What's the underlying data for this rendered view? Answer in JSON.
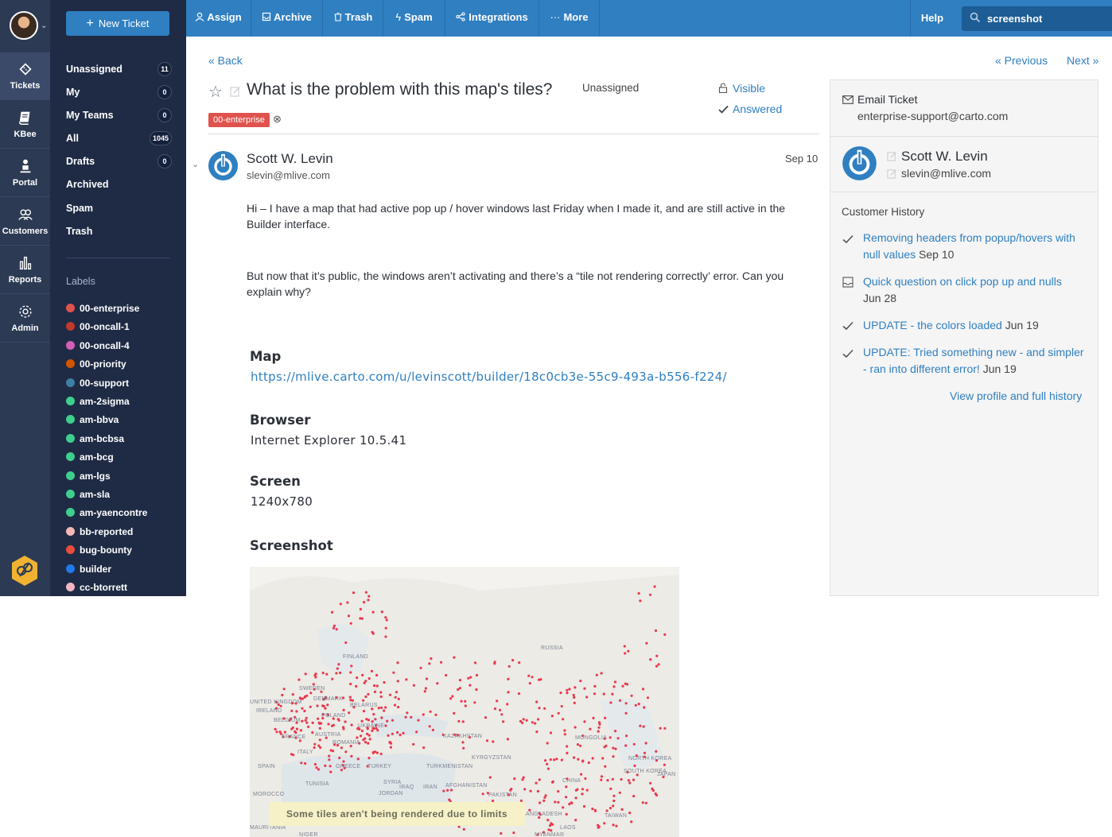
{
  "rail": {
    "items": [
      {
        "label": "Tickets",
        "icon": "ticket-icon"
      },
      {
        "label": "KBee",
        "icon": "book-icon"
      },
      {
        "label": "Portal",
        "icon": "portal-icon"
      },
      {
        "label": "Customers",
        "icon": "customers-icon"
      },
      {
        "label": "Reports",
        "icon": "reports-icon"
      },
      {
        "label": "Admin",
        "icon": "gear-icon"
      }
    ]
  },
  "sidebar": {
    "new_ticket": "New Ticket",
    "folders": [
      {
        "label": "Unassigned",
        "count": "11"
      },
      {
        "label": "My",
        "count": "0"
      },
      {
        "label": "My Teams",
        "count": "0"
      },
      {
        "label": "All",
        "count": "1045"
      },
      {
        "label": "Drafts",
        "count": "0"
      },
      {
        "label": "Archived",
        "count": ""
      },
      {
        "label": "Spam",
        "count": ""
      },
      {
        "label": "Trash",
        "count": ""
      }
    ],
    "labels_title": "Labels",
    "labels": [
      {
        "name": "00-enterprise",
        "color": "#e0524d"
      },
      {
        "name": "00-oncall-1",
        "color": "#c0392b"
      },
      {
        "name": "00-oncall-4",
        "color": "#d35fb7"
      },
      {
        "name": "00-priority",
        "color": "#d35400"
      },
      {
        "name": "00-support",
        "color": "#3d7ea6"
      },
      {
        "name": "am-2sigma",
        "color": "#3ecf8e"
      },
      {
        "name": "am-bbva",
        "color": "#3ecf8e"
      },
      {
        "name": "am-bcbsa",
        "color": "#3ecf8e"
      },
      {
        "name": "am-bcg",
        "color": "#3ecf8e"
      },
      {
        "name": "am-lgs",
        "color": "#3ecf8e"
      },
      {
        "name": "am-sla",
        "color": "#3ecf8e"
      },
      {
        "name": "am-yaencontre",
        "color": "#3ecf8e"
      },
      {
        "name": "bb-reported",
        "color": "#f4b6b6"
      },
      {
        "name": "bug-bounty",
        "color": "#e74c3c"
      },
      {
        "name": "builder",
        "color": "#1f7bea"
      },
      {
        "name": "cc-btorrett",
        "color": "#f4b6c2"
      }
    ]
  },
  "toolbar": {
    "buttons": [
      {
        "label": "Assign",
        "icon": "user-icon"
      },
      {
        "label": "Archive",
        "icon": "archive-icon"
      },
      {
        "label": "Trash",
        "icon": "trash-icon"
      },
      {
        "label": "Spam",
        "icon": "bolt-icon"
      },
      {
        "label": "Integrations",
        "icon": "share-icon"
      },
      {
        "label": "More",
        "icon": "ellipsis-icon"
      }
    ],
    "help": "Help",
    "search_value": "screenshot"
  },
  "ticket": {
    "back": "« Back",
    "previous": "« Previous",
    "next": "Next »",
    "title": "What is the problem with this map's tiles?",
    "assignee": "Unassigned",
    "visibility": "Visible",
    "status": "Answered",
    "tag": "00-enterprise",
    "message": {
      "sender": "Scott W. Levin",
      "email": "slevin@mlive.com",
      "date": "Sep 10",
      "para1": "Hi – I have a map that had active pop up / hover windows last Friday when I made it, and are still active in the Builder interface.",
      "para2": "But now that it’s public, the windows aren’t activating and there’s a “tile not rendering correctly’ error. Can you explain why?",
      "fields": {
        "map_label": "Map",
        "map_value": "https://mlive.carto.com/u/levinscott/builder/18c0cb3e-55c9-493a-b556-f224/",
        "browser_label": "Browser",
        "browser_value": "Internet Explorer 10.5.41",
        "screen_label": "Screen",
        "screen_value": "1240x780",
        "screenshot_label": "Screenshot"
      },
      "map_notice": "Some tiles aren't being rendered due to limits",
      "map_countries": [
        "RUSSIA",
        "FINLAND",
        "SWEDEN",
        "DENMARK",
        "UNITED KINGDOM",
        "IRELAND",
        "BELARUS",
        "POLAND",
        "BELGIUM",
        "UKRAINE",
        "FRANCE",
        "AUSTRIA",
        "ROMANIA",
        "ITALY",
        "SPAIN",
        "GREECE",
        "TURKEY",
        "KAZAKHSTAN",
        "MONGOLIA",
        "KYRGYZSTAN",
        "TURKMENISTAN",
        "NORTH KOREA",
        "SOUTH KOREA",
        "JAPAN",
        "TUNISIA",
        "SYRIA",
        "IRAQ",
        "IRAN",
        "AFGHANISTAN",
        "CHINA",
        "PAKISTAN",
        "MOROCCO",
        "JORDAN",
        "TAIWAN",
        "LAOS",
        "MYANMAR",
        "NIGER",
        "MAURITANIA",
        "BANGLADESH"
      ]
    }
  },
  "panel": {
    "email_ticket": "Email Ticket",
    "support_email": "enterprise-support@carto.com",
    "customer_name": "Scott W. Levin",
    "customer_email": "slevin@mlive.com",
    "history_title": "Customer History",
    "history": [
      {
        "title": "Removing headers from popup/hovers with null values",
        "date": "Sep 10",
        "icon": "check-icon"
      },
      {
        "title": "Quick question on click pop up and nulls",
        "date": "Jun 28",
        "icon": "inbox-icon"
      },
      {
        "title": "UPDATE - the colors loaded",
        "date": "Jun 19",
        "icon": "check-icon"
      },
      {
        "title": "UPDATE: Tried something new - and simpler - ran into different error!",
        "date": "Jun 19",
        "icon": "check-icon"
      }
    ],
    "view_profile": "View profile and full history"
  }
}
